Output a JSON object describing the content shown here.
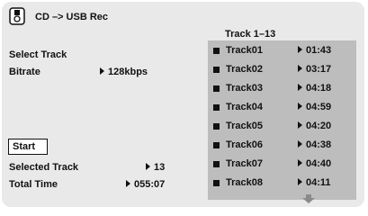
{
  "header": {
    "title": "CD –> USB Rec",
    "icon": "usb-disc-icon"
  },
  "settings": {
    "select_track_label": "Select Track",
    "bitrate_label": "Bitrate",
    "bitrate_value": "128kbps"
  },
  "start_button": {
    "label": "Start"
  },
  "summary": {
    "selected_track_label": "Selected Track",
    "selected_track_value": "13",
    "total_time_label": "Total Time",
    "total_time_value": "055:07"
  },
  "tracklist": {
    "header": "Track  1–13",
    "tracks": [
      {
        "name": "Track01",
        "time": "01:43"
      },
      {
        "name": "Track02",
        "time": "03:17"
      },
      {
        "name": "Track03",
        "time": "04:18"
      },
      {
        "name": "Track04",
        "time": "04:59"
      },
      {
        "name": "Track05",
        "time": "04:20"
      },
      {
        "name": "Track06",
        "time": "04:38"
      },
      {
        "name": "Track07",
        "time": "04:40"
      },
      {
        "name": "Track08",
        "time": "04:11"
      }
    ],
    "scroll_icon": "arrow-down-icon"
  },
  "colors": {
    "background": "#e9e9e9",
    "panel": "#bdbdbd",
    "text": "#111111",
    "arrow": "#8a8a8a"
  }
}
